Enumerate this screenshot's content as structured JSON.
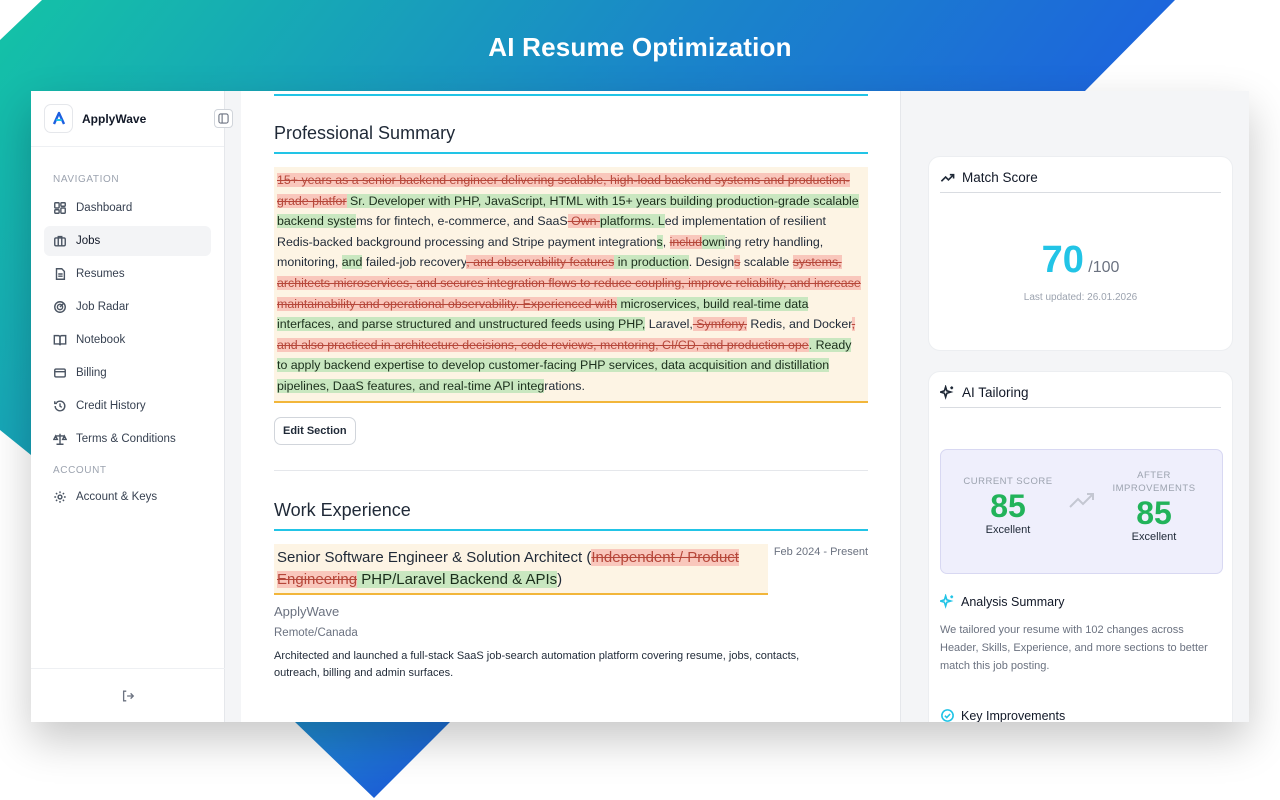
{
  "promo": {
    "title": "AI Resume Optimization"
  },
  "colors": {
    "accent": "#22c4e6",
    "gradient_start": "#14c3a6",
    "gradient_end": "#1d5fe0",
    "insert": "#c9e7c0",
    "delete": "#f9c7bc",
    "score_green": "#22b35a"
  },
  "app": {
    "name": "ApplyWave",
    "logo_text": "ApplyWave"
  },
  "sidebar": {
    "navigation_label": "NAVIGATION",
    "items": [
      {
        "label": "Dashboard",
        "icon": "dashboard-icon"
      },
      {
        "label": "Jobs",
        "icon": "briefcase-icon"
      },
      {
        "label": "Resumes",
        "icon": "document-icon"
      },
      {
        "label": "Job Radar",
        "icon": "radar-icon"
      },
      {
        "label": "Notebook",
        "icon": "book-icon"
      },
      {
        "label": "Billing",
        "icon": "credit-card-icon"
      },
      {
        "label": "Credit History",
        "icon": "history-icon"
      },
      {
        "label": "Terms & Conditions",
        "icon": "scale-icon"
      }
    ],
    "account_label": "ACCOUNT",
    "account_items": [
      {
        "label": "Account & Keys",
        "icon": "gear-icon"
      }
    ],
    "footer_icon": "logout-icon",
    "collapse_icon": "sidebar-collapse-icon"
  },
  "document": {
    "summary_heading": "Professional Summary",
    "summary_segments": [
      {
        "t": "del",
        "text": "15+ years as a senior backend engineer delivering scalable, high-load backend systems and production-grade platfor"
      },
      {
        "t": "ins",
        "text": " Sr. Developer with PHP, JavaScript, HTML with 15+ years building production-grade scalable backend syste"
      },
      {
        "t": "plain",
        "text": "ms for fintech, e-commerce, and SaaS"
      },
      {
        "t": "del",
        "text": " Own "
      },
      {
        "t": "ins",
        "text": " platforms. L"
      },
      {
        "t": "plain",
        "text": "ed implementation of resilient Redis-backed background processing and Stripe payment integration"
      },
      {
        "t": "ins",
        "text": "s"
      },
      {
        "t": "plain",
        "text": ", "
      },
      {
        "t": "del",
        "text": "includ"
      },
      {
        "t": "ins",
        "text": "own"
      },
      {
        "t": "plain",
        "text": "ing retry handling, monitoring, "
      },
      {
        "t": "ins",
        "text": "and"
      },
      {
        "t": "plain",
        "text": " failed-job recovery"
      },
      {
        "t": "del",
        "text": ", and observability features"
      },
      {
        "t": "ins",
        "text": " in production"
      },
      {
        "t": "plain",
        "text": ". Design"
      },
      {
        "t": "del",
        "text": "s"
      },
      {
        "t": "plain",
        "text": " scalable "
      },
      {
        "t": "del",
        "text": "systems, architects microservices, and secures integration flows to reduce coupling, improve reliability, and increase maintainability and operational observability. Experienced with"
      },
      {
        "t": "ins",
        "text": " microservices, build real-time data interfaces, and parse structured and unstructured feeds using PHP,"
      },
      {
        "t": "plain",
        "text": " Laravel,"
      },
      {
        "t": "del",
        "text": " Symfony,"
      },
      {
        "t": "plain",
        "text": " Redis, and Docker"
      },
      {
        "t": "del",
        "text": ", and also practiced in architecture decisions, code reviews, mentoring, CI/CD, and production ope"
      },
      {
        "t": "ins",
        "text": ". Ready to apply backend expertise to develop customer-facing PHP services, data acquisition and distillation pipelines, DaaS features, and real-time API integ"
      },
      {
        "t": "plain",
        "text": "rations."
      }
    ],
    "edit_button": "Edit Section",
    "work_heading": "Work Experience",
    "job": {
      "title_segments": [
        {
          "t": "plain",
          "text": "Senior Software Engineer & Solution Architect ("
        },
        {
          "t": "del",
          "text": "Independent / Product Engineering"
        },
        {
          "t": "ins",
          "text": " PHP/Laravel Backend & APIs"
        },
        {
          "t": "plain",
          "text": ")"
        }
      ],
      "date": "Feb 2024 - Present",
      "company": "ApplyWave",
      "location": "Remote/Canada",
      "description": "Architected and launched a full-stack SaaS job-search automation platform covering resume, jobs, contacts, outreach, billing and admin surfaces."
    }
  },
  "match_score": {
    "title": "Match Score",
    "icon": "trending-up-icon",
    "score": "70",
    "out_of": "/100",
    "updated": "Last updated: 26.01.2026"
  },
  "ai_tailoring": {
    "title": "AI Tailoring",
    "icon": "sparkles-icon",
    "current_label": "CURRENT SCORE",
    "current_score": "85",
    "current_quality": "Excellent",
    "after_label": "AFTER IMPROVEMENTS",
    "after_score": "85",
    "after_quality": "Excellent",
    "analysis_title": "Analysis Summary",
    "analysis_text": "We tailored your resume with 102 changes across Header, Skills, Experience, and more sections to better match this job posting.",
    "key_title": "Key Improvements"
  }
}
